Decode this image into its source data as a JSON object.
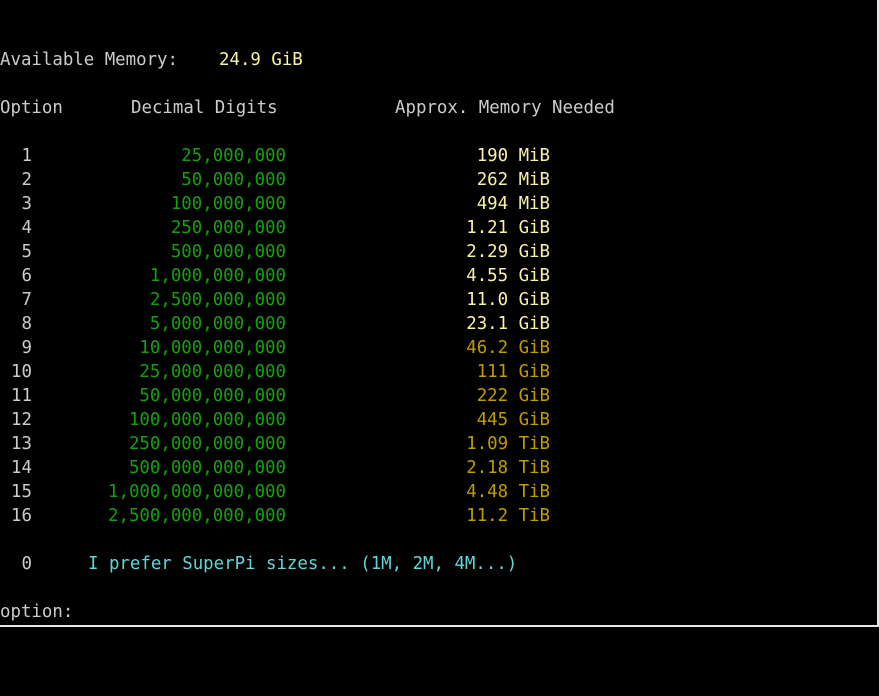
{
  "memory": {
    "label": "Available Memory:",
    "value": "24.9 GiB"
  },
  "headers": {
    "option": "Option",
    "digits": "Decimal Digits",
    "memory": "Approx. Memory Needed"
  },
  "rows": [
    {
      "option": "1",
      "digits": "25,000,000",
      "memory": "190 MiB"
    },
    {
      "option": "2",
      "digits": "50,000,000",
      "memory": "262 MiB"
    },
    {
      "option": "3",
      "digits": "100,000,000",
      "memory": "494 MiB"
    },
    {
      "option": "4",
      "digits": "250,000,000",
      "memory": "1.21 GiB"
    },
    {
      "option": "5",
      "digits": "500,000,000",
      "memory": "2.29 GiB"
    },
    {
      "option": "6",
      "digits": "1,000,000,000",
      "memory": "4.55 GiB"
    },
    {
      "option": "7",
      "digits": "2,500,000,000",
      "memory": "11.0 GiB"
    },
    {
      "option": "8",
      "digits": "5,000,000,000",
      "memory": "23.1 GiB"
    },
    {
      "option": "9",
      "digits": "10,000,000,000",
      "memory": "46.2 GiB"
    },
    {
      "option": "10",
      "digits": "25,000,000,000",
      "memory": "111 GiB"
    },
    {
      "option": "11",
      "digits": "50,000,000,000",
      "memory": "222 GiB"
    },
    {
      "option": "12",
      "digits": "100,000,000,000",
      "memory": "445 GiB"
    },
    {
      "option": "13",
      "digits": "250,000,000,000",
      "memory": "1.09 TiB"
    },
    {
      "option": "14",
      "digits": "500,000,000,000",
      "memory": "2.18 TiB"
    },
    {
      "option": "15",
      "digits": "1,000,000,000,000",
      "memory": "4.48 TiB"
    },
    {
      "option": "16",
      "digits": "2,500,000,000,000",
      "memory": "11.2 TiB"
    }
  ],
  "superpi": {
    "option": "0",
    "text": "I prefer SuperPi sizes... (1M, 2M, 4M...)"
  },
  "prompt": {
    "label": "option:",
    "value": ""
  },
  "colors": {
    "background": "#000000",
    "text": "#cccccc",
    "highlight_yellow": "#f9f1a5",
    "digits_green": "#13a10e",
    "exceeds_memory_gold": "#c19c00",
    "superpi_cyan": "#61d6d6"
  }
}
